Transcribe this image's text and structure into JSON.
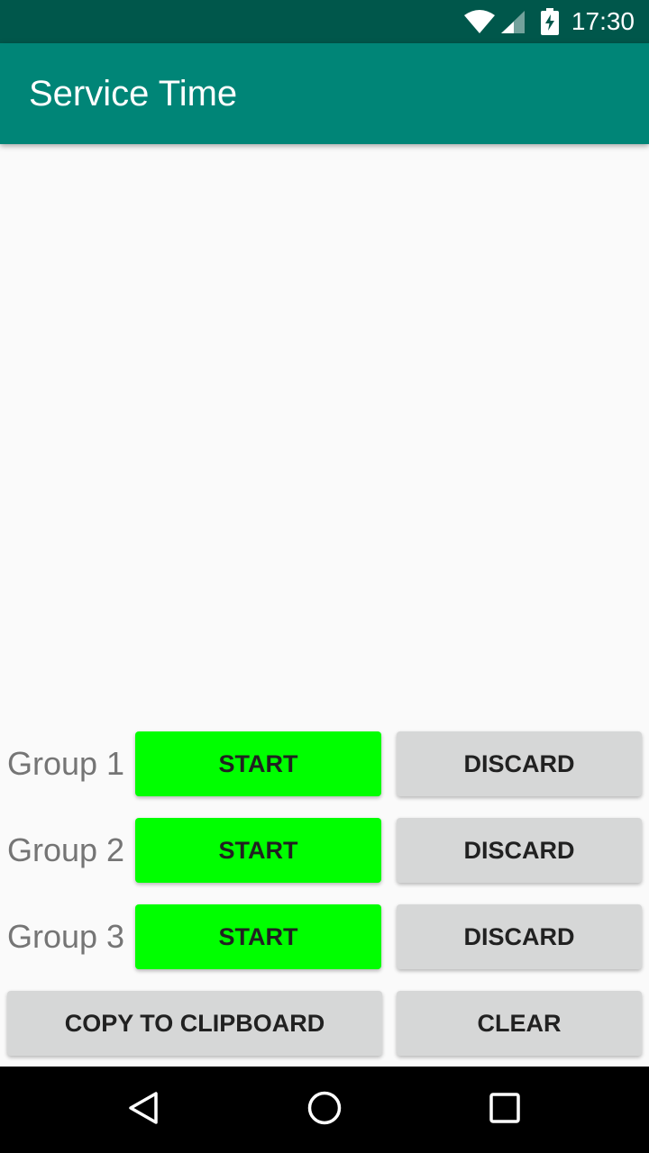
{
  "status_bar": {
    "time": "17:30",
    "icons": [
      "wifi-icon",
      "cell-signal-icon",
      "battery-charging-icon"
    ]
  },
  "app_bar": {
    "title": "Service Time",
    "color": "#008577"
  },
  "groups": [
    {
      "label": "Group 1",
      "start_label": "START",
      "discard_label": "DISCARD"
    },
    {
      "label": "Group 2",
      "start_label": "START",
      "discard_label": "DISCARD"
    },
    {
      "label": "Group 3",
      "start_label": "START",
      "discard_label": "DISCARD"
    }
  ],
  "actions": {
    "copy_label": "COPY TO CLIPBOARD",
    "clear_label": "CLEAR"
  },
  "nav_bar": {
    "icons": [
      "back-icon",
      "home-icon",
      "recents-icon"
    ]
  },
  "colors": {
    "status_bar": "#00574b",
    "start_button": "#00ff00",
    "secondary_button": "#d6d7d7"
  }
}
